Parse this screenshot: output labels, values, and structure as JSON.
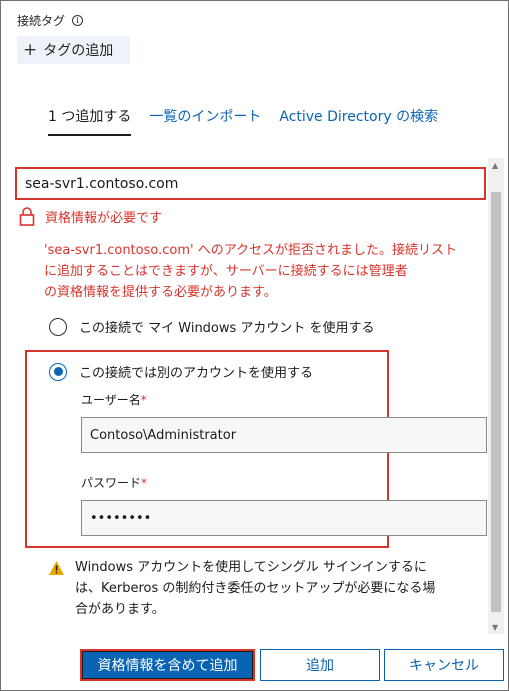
{
  "tags": {
    "title": "接続タグ",
    "add_label": "タグの追加"
  },
  "tabs": [
    {
      "label": "1 つ追加する",
      "active": true
    },
    {
      "label": "一覧のインポート",
      "active": false
    },
    {
      "label": "Active Directory の検索",
      "active": false
    }
  ],
  "server": {
    "value": "sea-svr1.contoso.com"
  },
  "credentials": {
    "required_label": "資格情報が必要です",
    "error_lines": [
      "'sea-svr1.contoso.com' へのアクセスが拒否されました。接続リスト",
      "に追加することはできますが、サーバーに接続するには管理者",
      "の資格情報を提供する必要があります。"
    ],
    "option_my_account": "この接続で マイ Windows アカウント を使用する",
    "option_other_account": "この接続では別のアカウントを使用する",
    "selected_option": "other",
    "username_label": "ユーザー名",
    "username_value": "Contoso\\Administrator",
    "password_label": "パスワード",
    "password_value": "••••••••",
    "required_marker": "*"
  },
  "notice": {
    "lines": [
      "Windows アカウントを使用してシングル サインインするに",
      "は、Kerberos の制約付き委任のセットアップが必要になる場",
      "合があります。"
    ]
  },
  "buttons": {
    "add_with_credentials": "資格情報を含めて追加",
    "add": "追加",
    "cancel": "キャンセル"
  },
  "colors": {
    "accent": "#0a64b4",
    "error": "#d9342b",
    "warning": "#e8a800"
  }
}
